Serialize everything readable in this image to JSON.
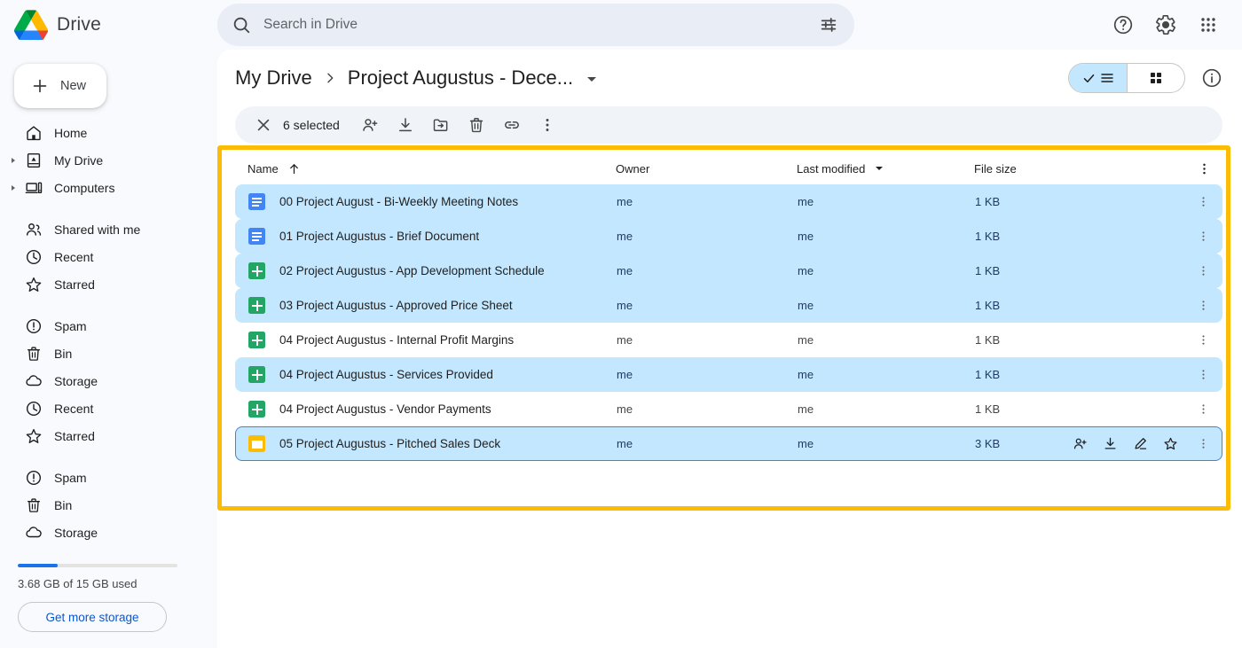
{
  "app": {
    "brand_name": "Drive",
    "logo_icon": "drive-logo"
  },
  "search": {
    "placeholder": "Search in Drive",
    "value": "",
    "search_icon": "search-icon",
    "filter_icon": "tune-icon"
  },
  "top_right": {
    "help_icon": "help-icon",
    "settings_icon": "gear-icon",
    "apps_icon": "apps-grid-icon"
  },
  "sidebar": {
    "new_button": {
      "label": "New",
      "icon": "plus-icon"
    },
    "groups": [
      {
        "items": [
          {
            "label": "Home",
            "icon": "home-icon",
            "expandable": false
          },
          {
            "label": "My Drive",
            "icon": "my-drive-icon",
            "expandable": true
          },
          {
            "label": "Computers",
            "icon": "computers-icon",
            "expandable": true
          }
        ]
      },
      {
        "items": [
          {
            "label": "Shared with me",
            "icon": "shared-people-icon",
            "expandable": false
          },
          {
            "label": "Recent",
            "icon": "clock-icon",
            "expandable": false
          },
          {
            "label": "Starred",
            "icon": "star-icon",
            "expandable": false
          }
        ]
      },
      {
        "items": [
          {
            "label": "Spam",
            "icon": "spam-icon",
            "expandable": false
          },
          {
            "label": "Bin",
            "icon": "trash-icon",
            "expandable": false
          },
          {
            "label": "Storage",
            "icon": "cloud-icon",
            "expandable": false
          },
          {
            "label": "Recent",
            "icon": "clock-icon",
            "expandable": false
          },
          {
            "label": "Starred",
            "icon": "star-icon",
            "expandable": false
          }
        ]
      },
      {
        "items": [
          {
            "label": "Spam",
            "icon": "spam-icon",
            "expandable": false
          },
          {
            "label": "Bin",
            "icon": "trash-icon",
            "expandable": false
          },
          {
            "label": "Storage",
            "icon": "cloud-icon",
            "expandable": false
          }
        ]
      }
    ],
    "storage": {
      "used_percent": 25,
      "text": "3.68 GB of 15 GB used",
      "button_label": "Get more storage"
    }
  },
  "breadcrumb": {
    "root": "My Drive",
    "separator_icon": "chevron-right-icon",
    "current": "Project Augustus - Dece...",
    "dropdown_icon": "caret-down-icon"
  },
  "view_controls": {
    "list_view_icon": "list-view-icon",
    "list_view_check_icon": "check-icon",
    "grid_view_icon": "grid-view-icon",
    "details_icon": "info-icon",
    "active_view": "list"
  },
  "selection_toolbar": {
    "close_icon": "close-icon",
    "count_label": "6 selected",
    "actions": [
      {
        "name": "share-button",
        "icon": "person-add-icon"
      },
      {
        "name": "download-button",
        "icon": "download-icon"
      },
      {
        "name": "move-button",
        "icon": "move-to-folder-icon"
      },
      {
        "name": "delete-button",
        "icon": "trash-icon"
      },
      {
        "name": "copy-link-button",
        "icon": "link-icon"
      },
      {
        "name": "more-actions-button",
        "icon": "kebab-icon"
      }
    ]
  },
  "table": {
    "columns": {
      "name": "Name",
      "owner": "Owner",
      "last_modified": "Last modified",
      "file_size": "File size"
    },
    "sort": {
      "column": "Name",
      "direction_icon": "arrow-up-icon"
    },
    "modified_caret_icon": "caret-down-icon",
    "header_kebab_icon": "kebab-icon",
    "rows": [
      {
        "name": "00 Project August - Bi-Weekly Meeting Notes",
        "type": "doc",
        "owner": "me",
        "last_modified": "me",
        "file_size": "1 KB",
        "selected": true,
        "focused": false
      },
      {
        "name": "01 Project Augustus - Brief Document",
        "type": "doc",
        "owner": "me",
        "last_modified": "me",
        "file_size": "1 KB",
        "selected": true,
        "focused": false
      },
      {
        "name": "02 Project Augustus - App Development Schedule",
        "type": "sheet",
        "owner": "me",
        "last_modified": "me",
        "file_size": "1 KB",
        "selected": true,
        "focused": false
      },
      {
        "name": "03 Project Augustus - Approved Price Sheet",
        "type": "sheet",
        "owner": "me",
        "last_modified": "me",
        "file_size": "1 KB",
        "selected": true,
        "focused": false
      },
      {
        "name": "04 Project Augustus - Internal Profit Margins",
        "type": "sheet",
        "owner": "me",
        "last_modified": "me",
        "file_size": "1 KB",
        "selected": false,
        "focused": false
      },
      {
        "name": "04 Project Augustus - Services Provided",
        "type": "sheet",
        "owner": "me",
        "last_modified": "me",
        "file_size": "1 KB",
        "selected": true,
        "focused": false
      },
      {
        "name": "04 Project Augustus - Vendor Payments",
        "type": "sheet",
        "owner": "me",
        "last_modified": "me",
        "file_size": "1 KB",
        "selected": false,
        "focused": false
      },
      {
        "name": "05 Project Augustus - Pitched Sales Deck",
        "type": "slide",
        "owner": "me",
        "last_modified": "me",
        "file_size": "3 KB",
        "selected": true,
        "focused": true,
        "hover_actions": [
          {
            "name": "share-button",
            "icon": "person-add-icon"
          },
          {
            "name": "download-button",
            "icon": "download-icon"
          },
          {
            "name": "rename-button",
            "icon": "pencil-icon"
          },
          {
            "name": "star-button",
            "icon": "star-icon"
          }
        ]
      }
    ]
  },
  "annotation": {
    "highlight_color": "#fcbc05",
    "target": "file-list-region"
  }
}
